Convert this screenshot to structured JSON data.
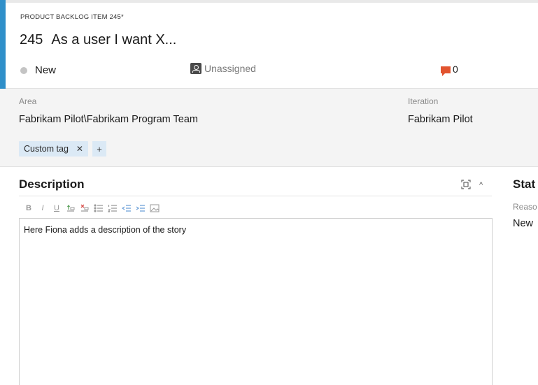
{
  "header": {
    "item_type": "PRODUCT BACKLOG ITEM 245*",
    "item_id": "245",
    "item_title": "As a user I want X...",
    "state": "New",
    "assignee": "Unassigned",
    "comment_count": "0"
  },
  "fields": {
    "area_label": "Area",
    "area_value": "Fabrikam Pilot\\Fabrikam Program Team",
    "iteration_label": "Iteration",
    "iteration_value": "Fabrikam Pilot",
    "tags": [
      {
        "label": "Custom tag",
        "remove": "✕"
      }
    ],
    "add_tag": "+"
  },
  "description": {
    "title": "Description",
    "collapse_glyph": "^",
    "toolbar": {
      "bold": "B",
      "italic": "I",
      "underline": "U"
    },
    "content": "Here Fiona adds a description of the story"
  },
  "status": {
    "title": "Stat",
    "reason_label": "Reaso",
    "reason_value": "New"
  },
  "colors": {
    "accent": "#2f8fc9",
    "tag_bg": "#dbe9f5",
    "comment": "#e2542f",
    "state_dot": "#c4c4c4"
  }
}
